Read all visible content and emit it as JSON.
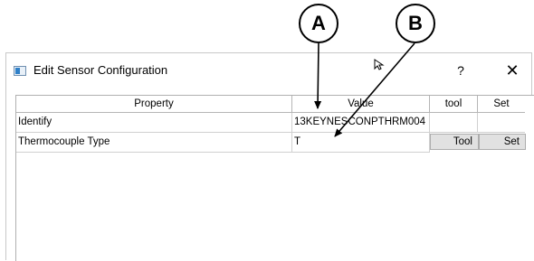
{
  "callouts": {
    "a": "A",
    "b": "B"
  },
  "dialog": {
    "title": "Edit Sensor Configuration",
    "help_glyph": "?",
    "close_glyph": "✕"
  },
  "table": {
    "headers": {
      "property": "Property",
      "value": "Value",
      "tool": "tool",
      "set": "Set"
    },
    "rows": [
      {
        "property": "Identify",
        "value": "13KEYNESCONPTHRM004",
        "tool": "",
        "set": ""
      },
      {
        "property": "Thermocouple Type",
        "value": "T",
        "tool": "Tool",
        "set": "Set"
      }
    ]
  },
  "colors": {
    "button_bg": "#e1e1e1",
    "grid": "#d0d0d0",
    "icon_accent": "#2f80c8"
  }
}
